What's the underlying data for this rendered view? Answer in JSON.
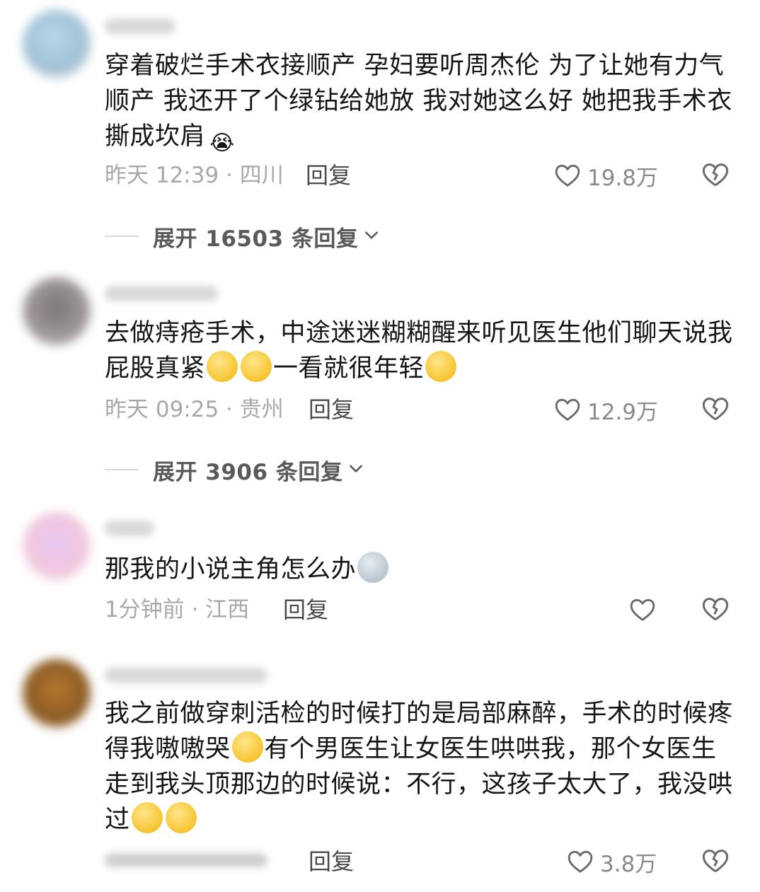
{
  "comments": [
    {
      "text_parts": [
        "穿着破烂手术衣接顺产 孕妇要听周杰伦 为了让她有力气顺产 我还开了个绿钻给她放 我对她这么好 她把我手术衣撕成坎肩"
      ],
      "emoji_end": "😭",
      "meta": "昨天 12:39 · 四川",
      "reply_label": "回复",
      "likes": "19.8万",
      "expand_label": "展开 16503 条回复"
    },
    {
      "text_parts": [
        "去做痔疮手术，中途迷迷糊糊醒来听见医生他们聊天说我屁股真紧",
        "一看就很年轻"
      ],
      "meta": "昨天 09:25 · 贵州",
      "reply_label": "回复",
      "likes": "12.9万",
      "expand_label": "展开 3906 条回复"
    },
    {
      "text_parts": [
        "那我的小说主角怎么办"
      ],
      "meta": "1分钟前 · 江西",
      "reply_label": "回复",
      "likes": ""
    },
    {
      "text_parts": [
        "我之前做穿刺活检的时候打的是局部麻醉，手术的时候疼得我嗷嗷哭",
        "有个男医生让女医生哄哄我，那个女医生走到我头顶那边的时候说：不行，这孩子太大了，我没哄过"
      ],
      "meta": "",
      "reply_label": "回复",
      "likes": "3.8万"
    }
  ],
  "icons": {
    "like": "heart-outline-icon",
    "dislike": "broken-heart-icon",
    "expand": "chevron-down-icon"
  },
  "colors": {
    "text": "#161616",
    "meta": "#a8a8a8",
    "accent_gray": "#5a5a5a"
  }
}
